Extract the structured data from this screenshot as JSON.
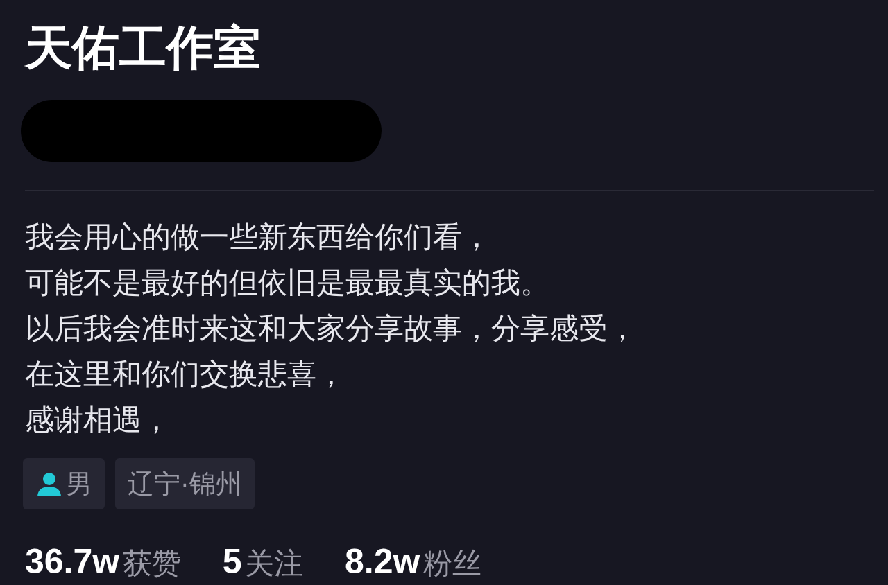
{
  "title": "天佑工作室",
  "bio": [
    "我会用心的做一些新东西给你们看，",
    "可能不是最好的但依旧是最最真实的我。",
    "以后我会准时来这和大家分享故事，分享感受，",
    "在这里和你们交换悲喜，",
    "感谢相遇，"
  ],
  "tags": [
    {
      "kind": "gender",
      "text": "男"
    },
    {
      "kind": "location",
      "text": "辽宁·锦州"
    }
  ],
  "stats": [
    {
      "count": "36.7w",
      "caption": "获赞"
    },
    {
      "count": "5",
      "caption": "关注"
    },
    {
      "count": "8.2w",
      "caption": "粉丝"
    }
  ]
}
